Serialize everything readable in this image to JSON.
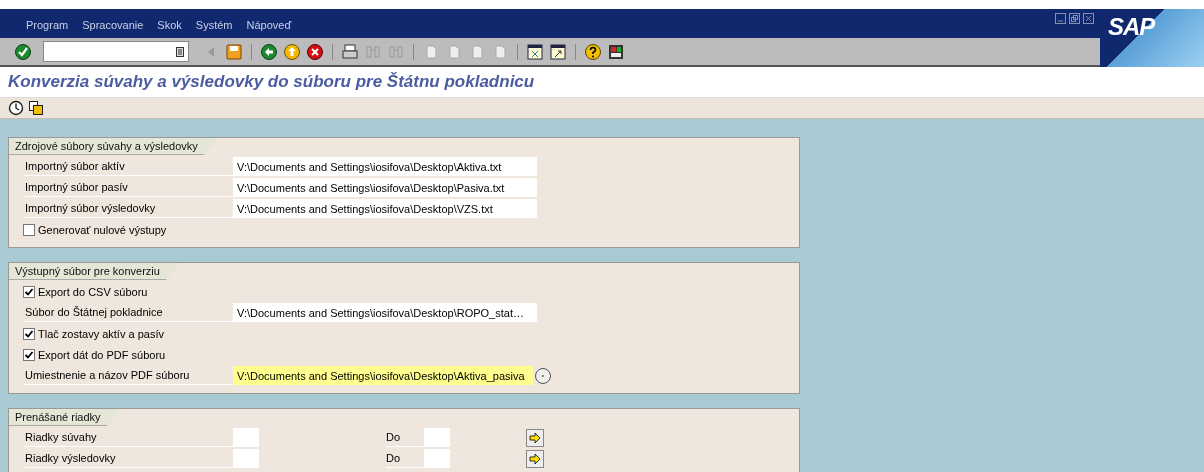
{
  "menu": [
    "Program",
    "Spracovanie",
    "Skok",
    "Systém",
    "Nápoveď"
  ],
  "logo": "SAP",
  "title": "Konverzia súvahy a výsledovky do súboru pre Štátnu pokladnicu",
  "sections": [
    {
      "title": "Zdrojové súbory súvahy a výsledovky",
      "rows": [
        {
          "kind": "field",
          "label": "Importný súbor aktív",
          "value": "V:\\Documents and Settings\\iosifova\\Desktop\\Aktiva.txt",
          "highlighted": false
        },
        {
          "kind": "field",
          "label": "Importný súbor pasív",
          "value": "V:\\Documents and Settings\\iosifova\\Desktop\\Pasiva.txt",
          "highlighted": false
        },
        {
          "kind": "field",
          "label": "Importný súbor výsledovky",
          "value": "V:\\Documents and Settings\\iosifova\\Desktop\\VZS.txt",
          "highlighted": false
        },
        {
          "kind": "checkbox",
          "label": "Generovať nulové výstupy",
          "checked": false
        }
      ]
    },
    {
      "title": "Výstupný súbor pre konverziu",
      "rows": [
        {
          "kind": "checkbox",
          "label": "Export do CSV súboru",
          "checked": true
        },
        {
          "kind": "field",
          "label": "Súbor do Štátnej pokladnice",
          "value": "V:\\Documents and Settings\\iosifova\\Desktop\\ROPO_stat…",
          "highlighted": false
        },
        {
          "kind": "checkbox",
          "label": "Tlač zostavy aktív a pasív",
          "checked": true
        },
        {
          "kind": "checkbox",
          "label": "Export dát do PDF súboru",
          "checked": true
        },
        {
          "kind": "field",
          "label": "Umiestnenie a názov PDF súboru",
          "value": "V:\\Documents and Settings\\iosifova\\Desktop\\Aktiva_pasiva",
          "highlighted": true
        }
      ]
    },
    {
      "title": "Prenášané riadky",
      "rows": [
        {
          "kind": "range",
          "label": "Riadky súvahy",
          "to_label": "Do"
        },
        {
          "kind": "range",
          "label": "Riadky výsledovky",
          "to_label": "Do"
        }
      ]
    }
  ]
}
